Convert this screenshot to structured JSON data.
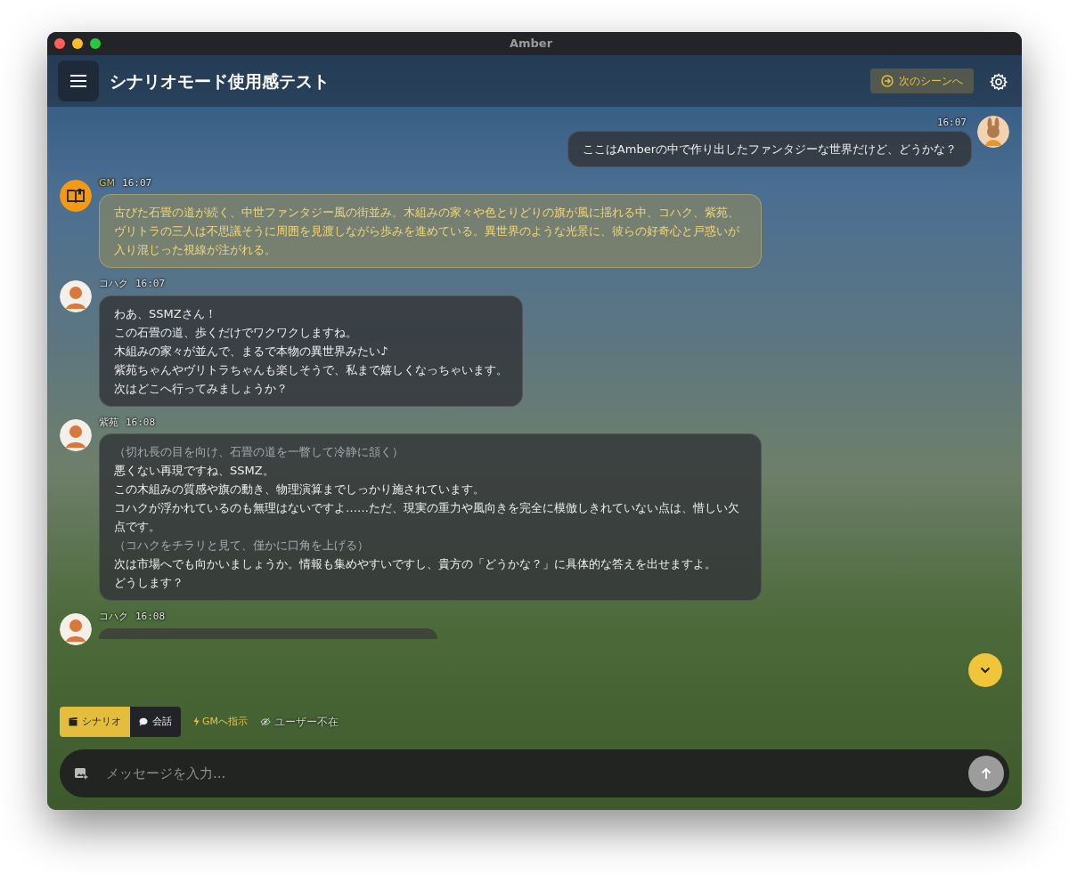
{
  "window": {
    "title": "Amber"
  },
  "header": {
    "title": "シナリオモード使用感テスト",
    "next_scene": "次のシーンへ"
  },
  "messages": [
    {
      "kind": "user",
      "time": "16:07",
      "lines": [
        {
          "kind": "speech",
          "text": "ここはAmberの中で作り出したファンタジーな世界だけど、どうかな？"
        }
      ]
    },
    {
      "kind": "gm",
      "sender": "GM",
      "time": "16:07",
      "lines": [
        {
          "kind": "narration",
          "text": "古びた石畳の道が続く、中世ファンタジー風の街並み。木組みの家々や色とりどりの旗が風に揺れる中、コハク、紫苑、ヴリトラの三人は不思議そうに周囲を見渡しながら歩みを進めている。異世界のような光景に、彼らの好奇心と戸惑いが入り混じった視線が注がれる。"
        }
      ]
    },
    {
      "kind": "character",
      "sender": "コハク",
      "time": "16:07",
      "lines": [
        {
          "kind": "speech",
          "text": "わあ、SSMZさん！"
        },
        {
          "kind": "speech",
          "text": "この石畳の道、歩くだけでワクワクしますね。"
        },
        {
          "kind": "speech",
          "text": "木組みの家々が並んで、まるで本物の異世界みたい♪"
        },
        {
          "kind": "speech",
          "text": "紫苑ちゃんやヴリトラちゃんも楽しそうで、私まで嬉しくなっちゃいます。"
        },
        {
          "kind": "speech",
          "text": "次はどこへ行ってみましょうか？"
        }
      ]
    },
    {
      "kind": "character",
      "sender": "紫苑",
      "time": "16:08",
      "lines": [
        {
          "kind": "action",
          "text": "（切れ長の目を向け、石畳の道を一瞥して冷静に頷く）"
        },
        {
          "kind": "speech",
          "text": "悪くない再現ですね、SSMZ。"
        },
        {
          "kind": "speech",
          "text": "この木組みの質感や旗の動き、物理演算までしっかり施されています。"
        },
        {
          "kind": "speech",
          "text": "コハクが浮かれているのも無理はないですよ……ただ、現実の重力や風向きを完全に模倣しきれていない点は、惜しい欠点です。"
        },
        {
          "kind": "action",
          "text": "（コハクをチラリと見て、僅かに口角を上げる）"
        },
        {
          "kind": "speech",
          "text": "次は市場へでも向かいましょうか。情報も集めやすいですし、貴方の「どうかな？」に具体的な答えを出せますよ。"
        },
        {
          "kind": "speech",
          "text": "どうします？"
        }
      ]
    },
    {
      "kind": "character",
      "sender": "コハク",
      "time": "16:08"
    }
  ],
  "modes": [
    {
      "label": "シナリオ",
      "selected": true
    },
    {
      "label": "会話",
      "selected": false
    }
  ],
  "gm_instruction": "GMへ指示",
  "user_absent": {
    "label": "ユーザー不在",
    "on": false
  },
  "composer": {
    "placeholder": "メッセージを入力..."
  }
}
